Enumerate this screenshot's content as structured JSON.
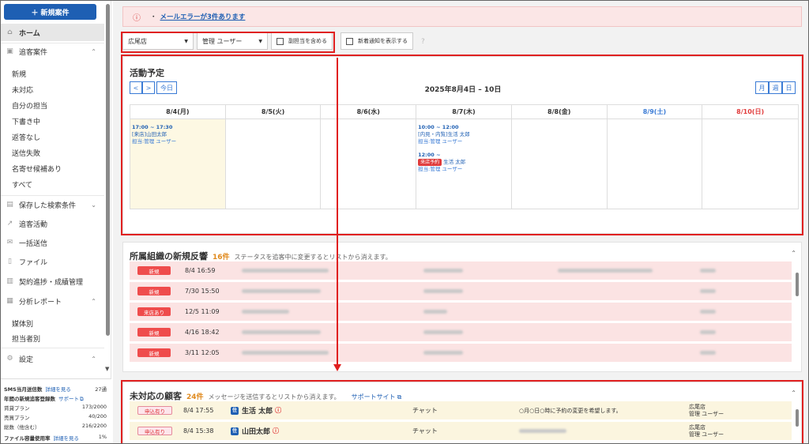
{
  "sidebar": {
    "new_button": "新規案件",
    "home": "ホーム",
    "follow_cases": "追客案件",
    "sub_items": [
      "新規",
      "未対応",
      "自分の担当",
      "下書き中",
      "返答なし",
      "送信失敗",
      "名寄せ候補あり",
      "すべて"
    ],
    "saved_search": "保存した検索条件",
    "follow_activity": "追客活動",
    "bulk_send": "一括送信",
    "files": "ファイル",
    "contract": "契約進捗・成績管理",
    "analysis": "分析レポート",
    "analysis_sub": [
      "媒体別",
      "担当者別"
    ],
    "settings": "設定",
    "bottom": {
      "sms_label": "SMS当月送信数",
      "sms_link": "詳細を見る",
      "sms_value": "27通",
      "annual_label": "年間の新規追客登録数",
      "annual_link": "サポート",
      "rent_label": "賃貸プラン",
      "rent_value": "173/2000",
      "sale_label": "売買プラン",
      "sale_value": "40/200",
      "total_label": "総数（他含む）",
      "total_value": "216/2200",
      "file_label": "ファイル容量使用率",
      "file_link": "詳細を見る",
      "file_value": "1%"
    }
  },
  "error_banner": {
    "bullet": "・",
    "text": "メールエラーが3件あります"
  },
  "filters": {
    "store": "広尾店",
    "user": "管理 ユーザー",
    "include_sub": "副担当を含める",
    "show_new": "新着通知を表示する"
  },
  "schedule": {
    "title": "活動予定",
    "prev": "<",
    "next": ">",
    "today": "今日",
    "range": "2025年8月4日 – 10日",
    "views": [
      "月",
      "週",
      "日"
    ],
    "days": [
      "8/4(月)",
      "8/5(火)",
      "8/6(水)",
      "8/7(木)",
      "8/8(金)",
      "8/9(土)",
      "8/10(日)"
    ],
    "events": {
      "mon": {
        "time": "17:00 ~ 17:30",
        "name": "[来店]山田太郎",
        "person": "担当:管理 ユーザー"
      },
      "thu1": {
        "time": "10:00 ~ 12:00",
        "name": "[内見・内覧]生活 太郎",
        "person": "担当:管理 ユーザー"
      },
      "thu2": {
        "time": "12:00 ~",
        "tag": "来店予約",
        "name": "生活 太郎",
        "person": "担当:管理 ユーザー"
      }
    }
  },
  "new_responses": {
    "title": "所属組織の新規反響",
    "count": "16件",
    "desc": "ステータスを追客中に変更するとリストから消えます。",
    "rows": [
      {
        "status": "新規",
        "date": "8/4 16:59"
      },
      {
        "status": "新規",
        "date": "7/30 15:50"
      },
      {
        "status": "来店あり",
        "date": "12/5 11:09"
      },
      {
        "status": "新規",
        "date": "4/16 18:42"
      },
      {
        "status": "新規",
        "date": "3/11 12:05"
      }
    ]
  },
  "unhandled": {
    "title": "未対応の顧客",
    "count": "24件",
    "desc": "メッセージを送信するとリストから消えます。",
    "support": "サポートサイト",
    "rows": [
      {
        "status": "申込有り",
        "date": "8/4 17:55",
        "name": "生活 太郎",
        "channel": "チャット",
        "message": "○月○日○時に予約の変更を希望します。",
        "store": "広尾店",
        "staff": "管理 ユーザー"
      },
      {
        "status": "申込有り",
        "date": "8/4 15:38",
        "name": "山田太郎",
        "channel": "チャット",
        "message": "",
        "store": "広尾店",
        "staff": "管理 ユーザー"
      }
    ]
  },
  "colors": {
    "brand": "#1e5fb3",
    "highlight": "#e02020",
    "count": "#e08a1e"
  }
}
